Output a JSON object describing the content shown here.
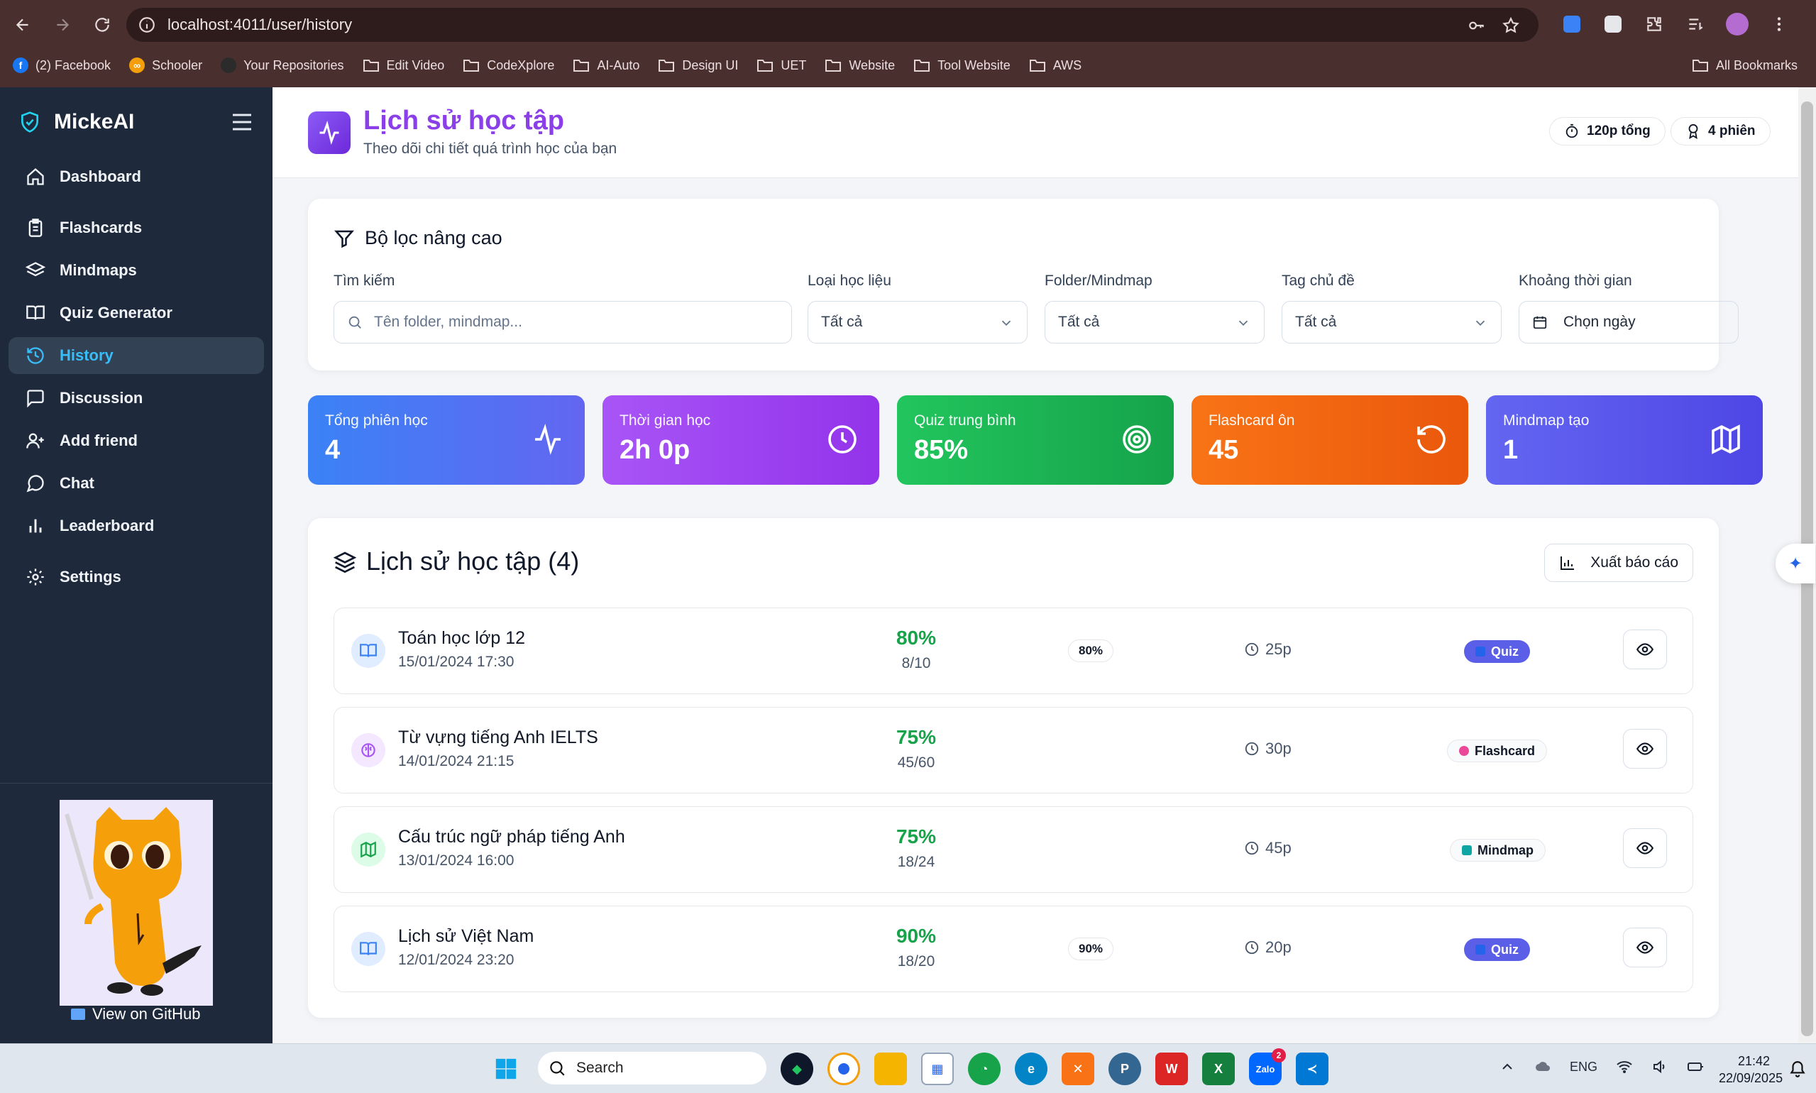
{
  "browser": {
    "url": "localhost:4011/user/history",
    "bookmarks": [
      {
        "label": "(2) Facebook",
        "icon": "facebook-icon",
        "color": "#1877f2"
      },
      {
        "label": "Schooler",
        "icon": "schooler-icon",
        "color": "#f59e0b"
      },
      {
        "label": "Your Repositories",
        "icon": "github-icon",
        "color": "#2b2b2b"
      },
      {
        "label": "Edit Video",
        "icon": "folder-icon"
      },
      {
        "label": "CodeXplore",
        "icon": "folder-icon"
      },
      {
        "label": "AI-Auto",
        "icon": "folder-icon"
      },
      {
        "label": "Design UI",
        "icon": "folder-icon"
      },
      {
        "label": "UET",
        "icon": "folder-icon"
      },
      {
        "label": "Website",
        "icon": "folder-icon"
      },
      {
        "label": "Tool Website",
        "icon": "folder-icon"
      },
      {
        "label": "AWS",
        "icon": "folder-icon"
      }
    ],
    "all_bookmarks": "All Bookmarks"
  },
  "sidebar": {
    "brand": "MickeAI",
    "items": [
      {
        "label": "Dashboard",
        "icon": "home-icon",
        "active": false
      },
      {
        "label": "Flashcards",
        "icon": "clipboard-icon",
        "active": false
      },
      {
        "label": "Mindmaps",
        "icon": "layers-icon",
        "active": false
      },
      {
        "label": "Quiz Generator",
        "icon": "book-open-icon",
        "active": false
      },
      {
        "label": "History",
        "icon": "history-icon",
        "active": true
      },
      {
        "label": "Discussion",
        "icon": "message-square-icon",
        "active": false
      },
      {
        "label": "Add friend",
        "icon": "user-plus-icon",
        "active": false
      },
      {
        "label": "Chat",
        "icon": "chat-icon",
        "active": false
      },
      {
        "label": "Leaderboard",
        "icon": "bar-chart-icon",
        "active": false
      },
      {
        "label": "Settings",
        "icon": "gear-icon",
        "active": false
      }
    ],
    "github_link": "View on GitHub"
  },
  "header": {
    "title": "Lịch sử học tập",
    "subtitle": "Theo dõi chi tiết quá trình học của bạn",
    "total_time": "120p tổng",
    "sessions": "4 phiên"
  },
  "filters": {
    "title": "Bộ lọc nâng cao",
    "search_label": "Tìm kiếm",
    "search_placeholder": "Tên folder, mindmap...",
    "type_label": "Loại học liệu",
    "type_value": "Tất cả",
    "folder_label": "Folder/Mindmap",
    "folder_value": "Tất cả",
    "tag_label": "Tag chủ đề",
    "tag_value": "Tất cả",
    "date_label": "Khoảng thời gian",
    "date_value": "Chọn ngày"
  },
  "stats": [
    {
      "label": "Tổng phiên học",
      "value": "4",
      "icon": "activity-icon",
      "color_from": "#3b82f6",
      "color_to": "#6366f1"
    },
    {
      "label": "Thời gian học",
      "value": "2h 0p",
      "icon": "clock-icon",
      "color_from": "#a855f7",
      "color_to": "#9333ea"
    },
    {
      "label": "Quiz trung bình",
      "value": "85%",
      "icon": "target-icon",
      "color_from": "#22c55e",
      "color_to": "#16a34a"
    },
    {
      "label": "Flashcard ôn",
      "value": "45",
      "icon": "rotate-ccw-icon",
      "color_from": "#f97316",
      "color_to": "#ea580c"
    },
    {
      "label": "Mindmap tạo",
      "value": "1",
      "icon": "map-icon",
      "color_from": "#6366f1",
      "color_to": "#4f46e5"
    }
  ],
  "history": {
    "title": "Lịch sử học tập (4)",
    "export_label": "Xuất báo cáo",
    "rows": [
      {
        "name": "Toán học lớp 12",
        "date": "15/01/2024 17:30",
        "score": "80%",
        "fraction": "8/10",
        "badge": "80%",
        "time": "25p",
        "type": "Quiz",
        "kind": "quiz"
      },
      {
        "name": "Từ vựng tiếng Anh IELTS",
        "date": "14/01/2024 21:15",
        "score": "75%",
        "fraction": "45/60",
        "badge": "",
        "time": "30p",
        "type": "Flashcard",
        "kind": "flashcard"
      },
      {
        "name": "Cấu trúc ngữ pháp tiếng Anh",
        "date": "13/01/2024 16:00",
        "score": "75%",
        "fraction": "18/24",
        "badge": "",
        "time": "45p",
        "type": "Mindmap",
        "kind": "mindmap"
      },
      {
        "name": "Lịch sử Việt Nam",
        "date": "12/01/2024 23:20",
        "score": "90%",
        "fraction": "18/20",
        "badge": "90%",
        "time": "20p",
        "type": "Quiz",
        "kind": "quiz"
      }
    ]
  },
  "taskbar": {
    "search_label": "Search",
    "language": "ENG",
    "time": "21:42",
    "date": "22/09/2025",
    "zalo_badge": "2"
  }
}
